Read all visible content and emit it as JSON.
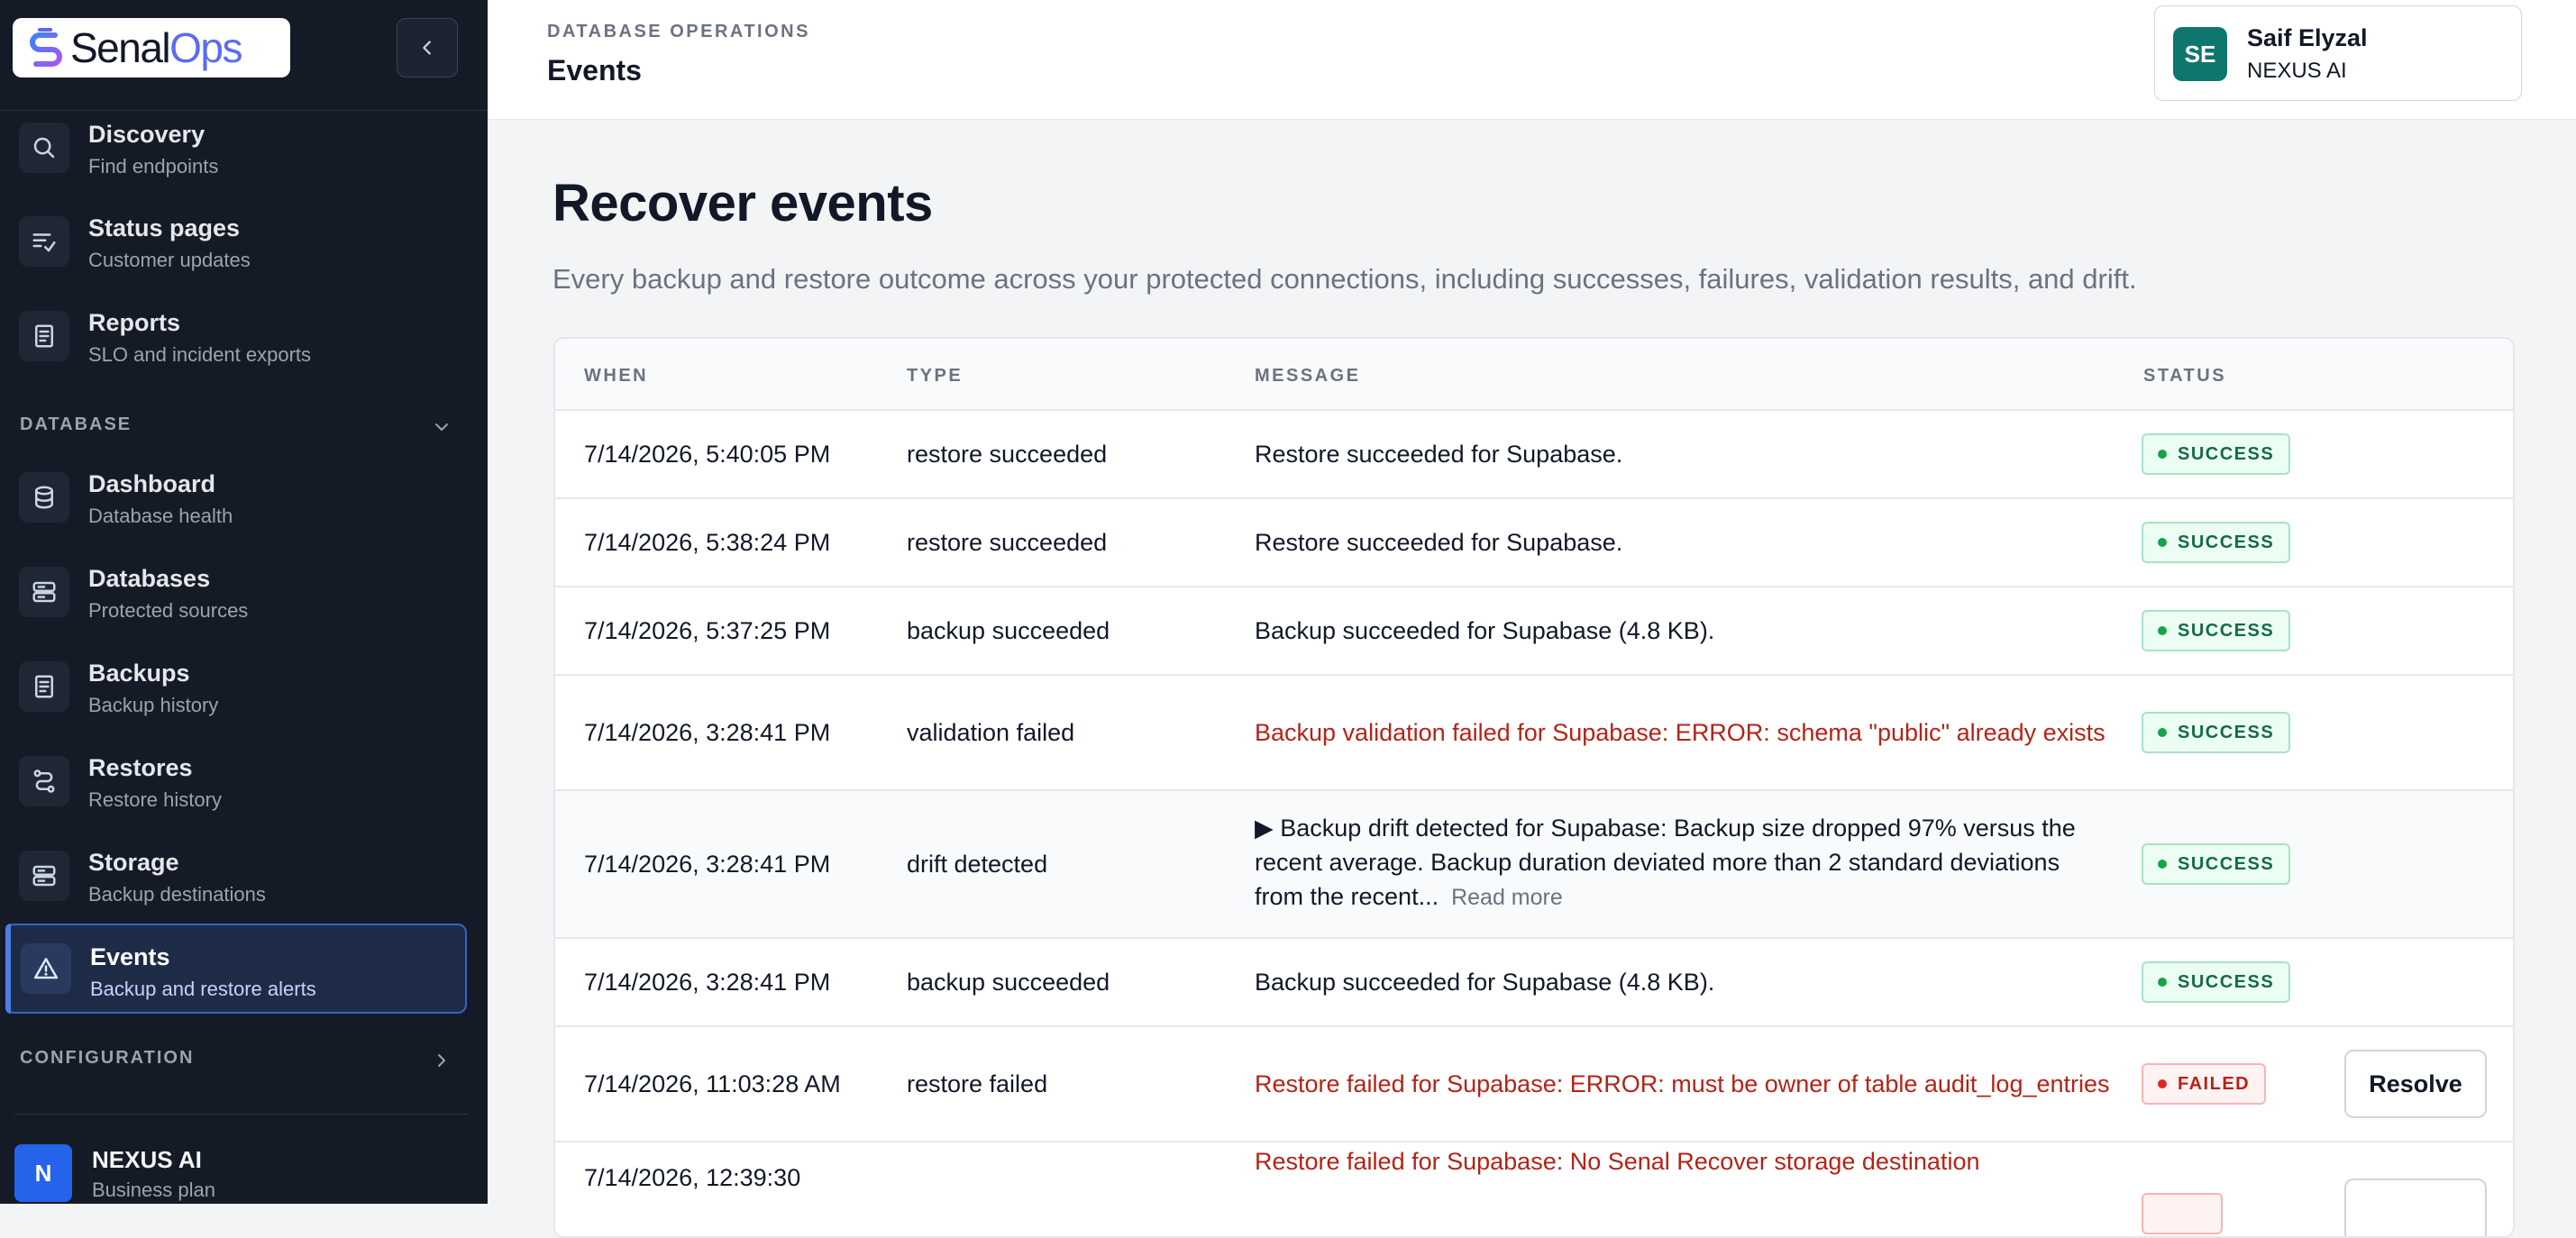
{
  "brand": {
    "name_part1": "Senal",
    "name_part2": "Ops"
  },
  "sidebar": {
    "items_top": [
      {
        "label": "Discovery",
        "sub": "Find endpoints"
      },
      {
        "label": "Status pages",
        "sub": "Customer updates"
      },
      {
        "label": "Reports",
        "sub": "SLO and incident exports"
      }
    ],
    "section_database": "DATABASE",
    "items_db": [
      {
        "label": "Dashboard",
        "sub": "Database health"
      },
      {
        "label": "Databases",
        "sub": "Protected sources"
      },
      {
        "label": "Backups",
        "sub": "Backup history"
      },
      {
        "label": "Restores",
        "sub": "Restore history"
      },
      {
        "label": "Storage",
        "sub": "Backup destinations"
      },
      {
        "label": "Events",
        "sub": "Backup and restore alerts",
        "active": true
      }
    ],
    "section_configuration": "CONFIGURATION",
    "org": {
      "initial": "N",
      "name": "NEXUS AI",
      "plan": "Business plan"
    }
  },
  "header": {
    "kicker": "DATABASE OPERATIONS",
    "title": "Events",
    "user": {
      "initials": "SE",
      "name": "Saif Elyzal",
      "org": "NEXUS AI"
    }
  },
  "main": {
    "title": "Recover events",
    "subtitle": "Every backup and restore outcome across your protected connections, including successes, failures, validation results, and drift.",
    "table": {
      "columns": [
        "WHEN",
        "TYPE",
        "MESSAGE",
        "STATUS"
      ],
      "rows": [
        {
          "when": "7/14/2026, 5:40:05 PM",
          "type": "restore succeeded",
          "message": "Restore succeeded for Supabase.",
          "status": "SUCCESS"
        },
        {
          "when": "7/14/2026, 5:38:24 PM",
          "type": "restore succeeded",
          "message": "Restore succeeded for Supabase.",
          "status": "SUCCESS"
        },
        {
          "when": "7/14/2026, 5:37:25 PM",
          "type": "backup succeeded",
          "message": "Backup succeeded for Supabase (4.8 KB).",
          "status": "SUCCESS"
        },
        {
          "when": "7/14/2026, 3:28:41 PM",
          "type": "validation failed",
          "message": "Backup validation failed for Supabase: ERROR: schema \"public\" already exists",
          "status": "SUCCESS"
        },
        {
          "when": "7/14/2026, 3:28:41 PM",
          "type": "drift detected",
          "message": "▶ Backup drift detected for Supabase: Backup size dropped 97% versus the recent average. Backup duration deviated more than 2 standard deviations from the recent...",
          "read_more": "Read more",
          "status": "SUCCESS"
        },
        {
          "when": "7/14/2026, 3:28:41 PM",
          "type": "backup succeeded",
          "message": "Backup succeeded for Supabase (4.8 KB).",
          "status": "SUCCESS"
        },
        {
          "when": "7/14/2026, 11:03:28 AM",
          "type": "restore failed",
          "message": "Restore failed for Supabase: ERROR: must be owner of table audit_log_entries",
          "status": "FAILED",
          "action": "Resolve"
        },
        {
          "when": "7/14/2026, 12:39:30",
          "type": "",
          "message": "Restore failed for Supabase: No Senal Recover storage destination",
          "status": "",
          "action": ""
        }
      ]
    }
  },
  "colors": {
    "sidebar_bg": "#141b26",
    "accent": "#4f7be6",
    "success": "#146c43",
    "error": "#b42318",
    "brand_accent": "#5b6cf0"
  },
  "icons": {
    "logo": "senal-s-logo",
    "collapse": "chevron-left-icon",
    "discovery": "search-icon",
    "status_pages": "checklist-icon",
    "reports": "document-icon",
    "dashboard": "database-icon",
    "databases": "server-stack-icon",
    "backups": "document-icon",
    "restores": "route-icon",
    "storage": "server-stack-icon",
    "events": "warning-triangle-icon"
  }
}
